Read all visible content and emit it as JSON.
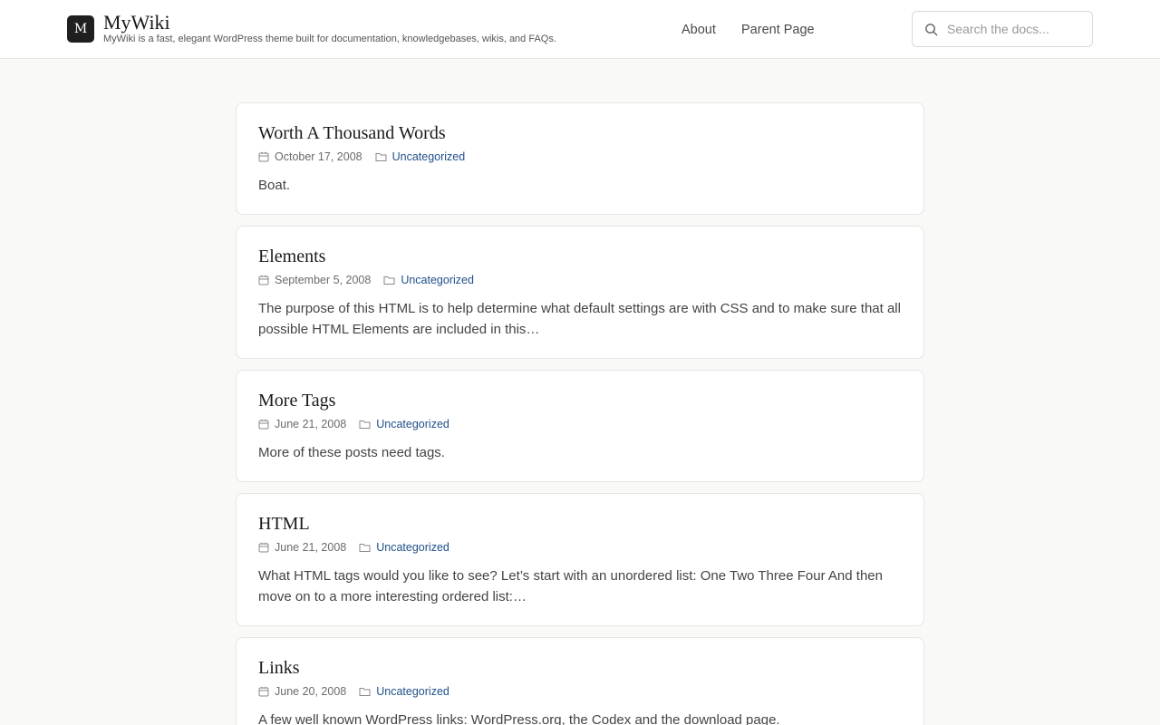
{
  "site": {
    "logo_letter": "M",
    "title": "MyWiki",
    "tagline": "MyWiki is a fast, elegant WordPress theme built for documentation, knowledgebases, wikis, and FAQs."
  },
  "nav": {
    "items": [
      {
        "label": "About"
      },
      {
        "label": "Parent Page"
      }
    ]
  },
  "search": {
    "placeholder": "Search the docs...",
    "value": ""
  },
  "colors": {
    "background": "#f9f9f7",
    "card": "#ffffff",
    "link": "#1f4f8a",
    "logo": "#1f1f1f"
  },
  "icons": {
    "search": "search-icon",
    "date": "calendar-icon",
    "category": "folder-icon"
  },
  "posts": [
    {
      "title": "Worth A Thousand Words",
      "date": "October 17, 2008",
      "category": "Uncategorized",
      "excerpt": "Boat."
    },
    {
      "title": "Elements",
      "date": "September 5, 2008",
      "category": "Uncategorized",
      "excerpt": "The purpose of this HTML is to help determine what default settings are with CSS and to make sure that all possible HTML Elements are included in this…"
    },
    {
      "title": "More Tags",
      "date": "June 21, 2008",
      "category": "Uncategorized",
      "excerpt": "More of these posts need tags."
    },
    {
      "title": "HTML",
      "date": "June 21, 2008",
      "category": "Uncategorized",
      "excerpt": "What HTML tags would you like to see? Let’s start with an unordered list: One Two Three Four And then move on to a more interesting ordered list:…"
    },
    {
      "title": "Links",
      "date": "June 20, 2008",
      "category": "Uncategorized",
      "excerpt": "A few well known WordPress links: WordPress.org, the Codex and the download page."
    }
  ]
}
